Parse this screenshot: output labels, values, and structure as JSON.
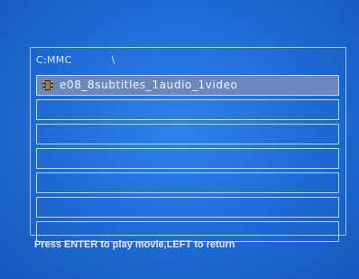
{
  "browser": {
    "drive": "C:MMC",
    "path": "\\"
  },
  "files": [
    {
      "name": "e08_8subtitles_1audio_1video",
      "icon": "film-icon",
      "selected": true
    },
    {
      "name": "",
      "icon": "",
      "selected": false
    },
    {
      "name": "",
      "icon": "",
      "selected": false
    },
    {
      "name": "",
      "icon": "",
      "selected": false
    },
    {
      "name": "",
      "icon": "",
      "selected": false
    },
    {
      "name": "",
      "icon": "",
      "selected": false
    },
    {
      "name": "",
      "icon": "",
      "selected": false
    },
    {
      "name": "",
      "icon": "",
      "selected": false
    }
  ],
  "footer": {
    "hint": "Press ENTER to play movie,LEFT to return"
  },
  "colors": {
    "background": "#1e6ad4",
    "selected_row": "#6a88bd",
    "row_border": "#bcd3f4"
  }
}
